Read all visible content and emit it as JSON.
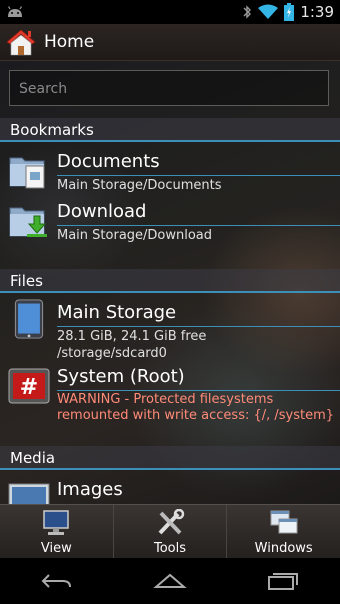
{
  "status_bar": {
    "time": "1:39"
  },
  "action_bar": {
    "title": "Home"
  },
  "search": {
    "placeholder": "Search"
  },
  "sections": {
    "bookmarks": "Bookmarks",
    "files": "Files",
    "media": "Media"
  },
  "bookmarks": [
    {
      "title": "Documents",
      "subtitle": "Main Storage/Documents"
    },
    {
      "title": "Download",
      "subtitle": "Main Storage/Download"
    }
  ],
  "files": [
    {
      "title": "Main Storage",
      "line1": "28.1 GiB, 24.1 GiB free",
      "line2": "/storage/sdcard0"
    },
    {
      "title": "System (Root)",
      "warn1": "WARNING - Protected filesystems",
      "warn2": "remounted with write access: {/, /system}"
    }
  ],
  "media": [
    {
      "title": "Images"
    }
  ],
  "bottom_tabs": [
    {
      "label": "View"
    },
    {
      "label": "Tools"
    },
    {
      "label": "Windows"
    }
  ],
  "colors": {
    "accent": "#3b8fb8",
    "warning": "#ff8a78",
    "home_roof": "#e23a2a"
  }
}
